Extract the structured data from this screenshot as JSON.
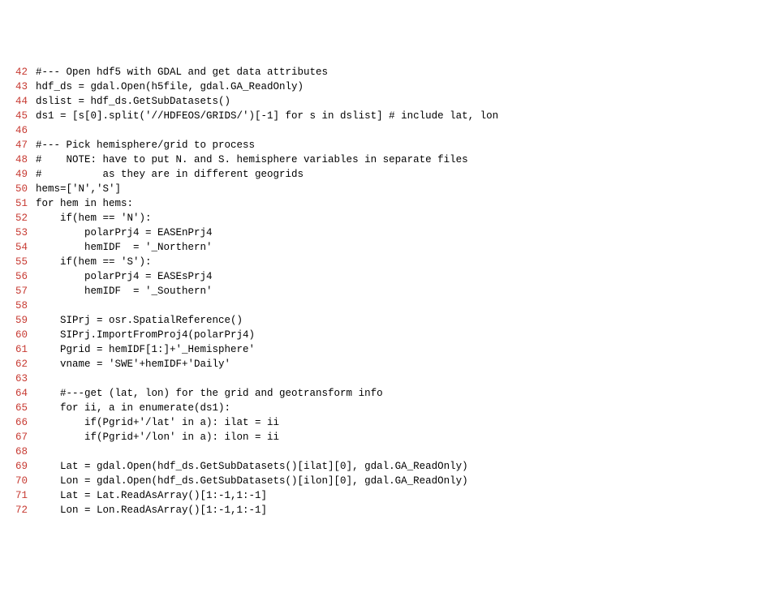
{
  "lines": [
    {
      "num": 42,
      "text": "#--- Open hdf5 with GDAL and get data attributes"
    },
    {
      "num": 43,
      "text": "hdf_ds = gdal.Open(h5file, gdal.GA_ReadOnly)"
    },
    {
      "num": 44,
      "text": "dslist = hdf_ds.GetSubDatasets()"
    },
    {
      "num": 45,
      "text": "ds1 = [s[0].split('//HDFEOS/GRIDS/')[-1] for s in dslist] # include lat, lon"
    },
    {
      "num": 46,
      "text": ""
    },
    {
      "num": 47,
      "text": "#--- Pick hemisphere/grid to process"
    },
    {
      "num": 48,
      "text": "#    NOTE: have to put N. and S. hemisphere variables in separate files"
    },
    {
      "num": 49,
      "text": "#          as they are in different geogrids"
    },
    {
      "num": 50,
      "text": "hems=['N','S']"
    },
    {
      "num": 51,
      "text": "for hem in hems:"
    },
    {
      "num": 52,
      "text": "    if(hem == 'N'):"
    },
    {
      "num": 53,
      "text": "        polarPrj4 = EASEnPrj4"
    },
    {
      "num": 54,
      "text": "        hemIDF  = '_Northern'"
    },
    {
      "num": 55,
      "text": "    if(hem == 'S'):"
    },
    {
      "num": 56,
      "text": "        polarPrj4 = EASEsPrj4"
    },
    {
      "num": 57,
      "text": "        hemIDF  = '_Southern'"
    },
    {
      "num": 58,
      "text": ""
    },
    {
      "num": 59,
      "text": "    SIPrj = osr.SpatialReference()"
    },
    {
      "num": 60,
      "text": "    SIPrj.ImportFromProj4(polarPrj4)"
    },
    {
      "num": 61,
      "text": "    Pgrid = hemIDF[1:]+'_Hemisphere'"
    },
    {
      "num": 62,
      "text": "    vname = 'SWE'+hemIDF+'Daily'"
    },
    {
      "num": 63,
      "text": ""
    },
    {
      "num": 64,
      "text": "    #---get (lat, lon) for the grid and geotransform info"
    },
    {
      "num": 65,
      "text": "    for ii, a in enumerate(ds1):"
    },
    {
      "num": 66,
      "text": "        if(Pgrid+'/lat' in a): ilat = ii"
    },
    {
      "num": 67,
      "text": "        if(Pgrid+'/lon' in a): ilon = ii"
    },
    {
      "num": 68,
      "text": ""
    },
    {
      "num": 69,
      "text": "    Lat = gdal.Open(hdf_ds.GetSubDatasets()[ilat][0], gdal.GA_ReadOnly)"
    },
    {
      "num": 70,
      "text": "    Lon = gdal.Open(hdf_ds.GetSubDatasets()[ilon][0], gdal.GA_ReadOnly)"
    },
    {
      "num": 71,
      "text": "    Lat = Lat.ReadAsArray()[1:-1,1:-1]"
    },
    {
      "num": 72,
      "text": "    Lon = Lon.ReadAsArray()[1:-1,1:-1]"
    }
  ]
}
